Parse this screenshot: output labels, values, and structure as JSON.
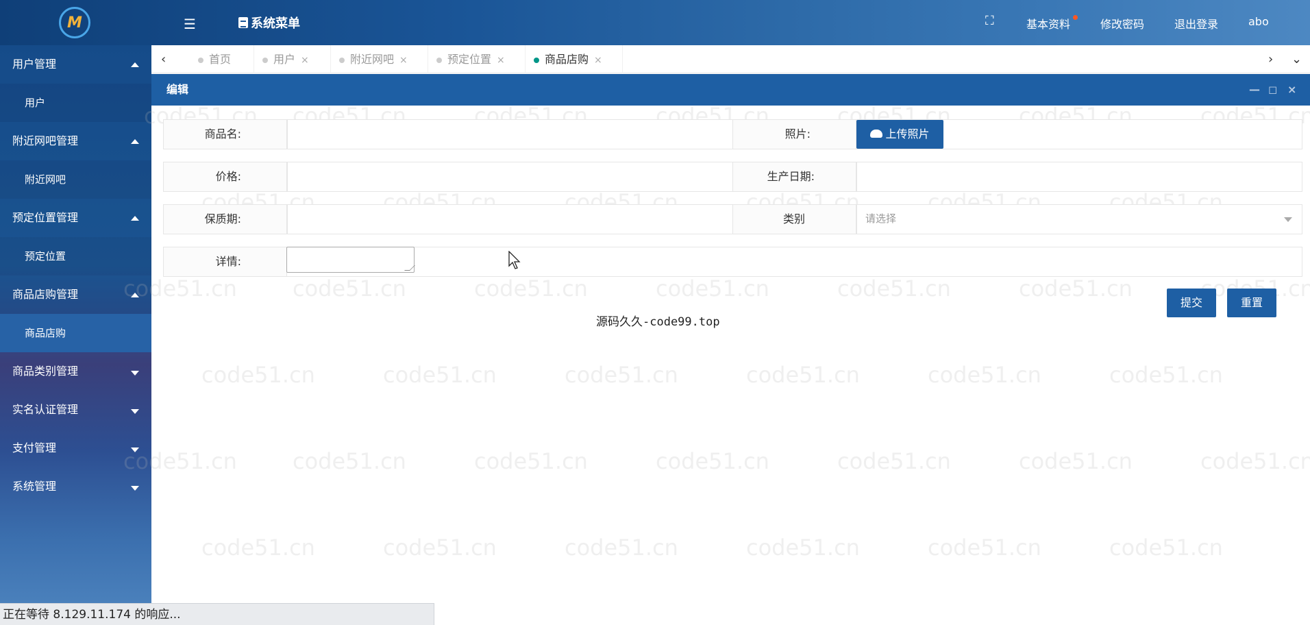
{
  "header": {
    "logo_text": "M",
    "menu_toggle_icon": "menu-fold-icon",
    "system_menu_label": "系统菜单",
    "fullscreen_icon": "⛶",
    "profile_label": "基本资料",
    "change_password_label": "修改密码",
    "logout_label": "退出登录",
    "username": "abo"
  },
  "sidebar": {
    "items": [
      {
        "label": "用户管理",
        "type": "parent",
        "expanded": true
      },
      {
        "label": "用户",
        "type": "child"
      },
      {
        "label": "附近网吧管理",
        "type": "parent",
        "expanded": true
      },
      {
        "label": "附近网吧",
        "type": "child"
      },
      {
        "label": "预定位置管理",
        "type": "parent",
        "expanded": true
      },
      {
        "label": "预定位置",
        "type": "child"
      },
      {
        "label": "商品店购管理",
        "type": "parent",
        "expanded": true
      },
      {
        "label": "商品店购",
        "type": "child",
        "active": true
      },
      {
        "label": "商品类别管理",
        "type": "parent",
        "expanded": false
      },
      {
        "label": "实名认证管理",
        "type": "parent",
        "expanded": false
      },
      {
        "label": "支付管理",
        "type": "parent",
        "expanded": false
      },
      {
        "label": "系统管理",
        "type": "parent",
        "expanded": false
      }
    ]
  },
  "tabs": {
    "prev_icon": "‹",
    "next_icon": "›",
    "more_icon": "⌄",
    "close_glyph": "×",
    "items": [
      {
        "label": "首页",
        "closable": false
      },
      {
        "label": "用户",
        "closable": true
      },
      {
        "label": "附近网吧",
        "closable": true
      },
      {
        "label": "预定位置",
        "closable": true
      },
      {
        "label": "商品店购",
        "closable": true,
        "active": true
      }
    ]
  },
  "panel": {
    "title": "编辑",
    "minimize_glyph": "—",
    "maximize_glyph": "◻",
    "close_glyph": "×"
  },
  "form": {
    "name_label": "商品名:",
    "photo_label": "照片:",
    "upload_label": "上传照片",
    "price_label": "价格:",
    "production_date_label": "生产日期:",
    "shelf_life_label": "保质期:",
    "category_label": "类别",
    "category_placeholder": "请选择",
    "details_label": "详情:",
    "submit_label": "提交",
    "reset_label": "重置"
  },
  "footer_text": "源码久久-code99.top",
  "watermark_text": "code51.cn",
  "status_bar_text": "正在等待 8.129.11.174 的响应...",
  "colors": {
    "primary": "#1e5fa4",
    "active_tab_dot": "#009688",
    "notify_dot": "#ff5722"
  }
}
